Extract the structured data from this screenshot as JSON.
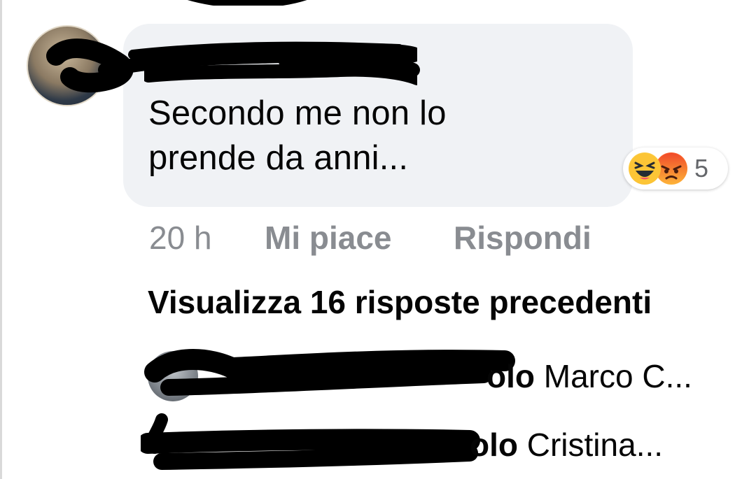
{
  "comment": {
    "author_name": "",
    "text_line1": "Secondo me non lo",
    "text_line2": "prende da anni...",
    "reactions": {
      "icons": [
        "haha-reaction-icon",
        "angry-reaction-icon"
      ],
      "count": "5"
    },
    "actions": {
      "time": "20 h",
      "like_label": "Mi piace",
      "reply_label": "Rispondi"
    }
  },
  "replies": {
    "view_previous_label": "Visualizza 16 risposte precedenti",
    "items": [
      {
        "author_suffix": "olo",
        "preview": "Marco C..."
      },
      {
        "author_suffix": "olo",
        "preview": "Cristina..."
      }
    ]
  },
  "colors": {
    "bubble_bg": "#f0f2f5",
    "text_primary": "#050505",
    "text_secondary": "#898c91",
    "redaction": "#000000"
  }
}
